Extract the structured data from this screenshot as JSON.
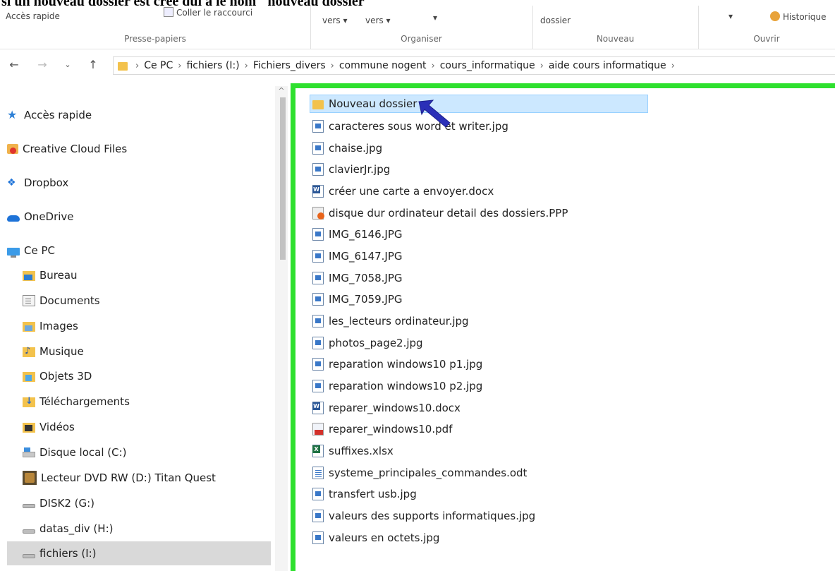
{
  "caption": "si un nouveau dossier est créé qui a le nom \"nouveau dossier\"",
  "ribbon": {
    "quick_access": "Accès rapide",
    "paste_shortcut": "Coller le raccourci",
    "move_to": "vers ▾",
    "copy_to": "vers ▾",
    "delete_arrow": "▾",
    "new_folder_label": "dossier",
    "properties_arrow": "▾",
    "history": "Historique",
    "groups": {
      "clipboard": "Presse-papiers",
      "organize": "Organiser",
      "new": "Nouveau",
      "open": "Ouvrir"
    }
  },
  "address": {
    "crumbs": [
      "Ce PC",
      "fichiers (I:)",
      "Fichiers_divers",
      "commune nogent",
      "cours_informatique",
      "aide cours informatique"
    ]
  },
  "sidebar": {
    "items": [
      {
        "label": "Accès rapide",
        "icon": "star-icon"
      },
      {
        "label": "Creative Cloud Files",
        "icon": "creative-cloud-icon"
      },
      {
        "label": "Dropbox",
        "icon": "dropbox-icon"
      },
      {
        "label": "OneDrive",
        "icon": "onedrive-icon"
      },
      {
        "label": "Ce PC",
        "icon": "computer-icon"
      },
      {
        "label": "Bureau",
        "icon": "desktop-folder-icon"
      },
      {
        "label": "Documents",
        "icon": "documents-icon"
      },
      {
        "label": "Images",
        "icon": "pictures-folder-icon"
      },
      {
        "label": "Musique",
        "icon": "music-folder-icon"
      },
      {
        "label": "Objets 3D",
        "icon": "3d-objects-icon"
      },
      {
        "label": "Téléchargements",
        "icon": "downloads-icon"
      },
      {
        "label": "Vidéos",
        "icon": "videos-folder-icon"
      },
      {
        "label": "Disque local (C:)",
        "icon": "local-disk-icon"
      },
      {
        "label": "Lecteur DVD RW (D:) Titan Quest",
        "icon": "dvd-drive-icon"
      },
      {
        "label": "DISK2 (G:)",
        "icon": "drive-icon"
      },
      {
        "label": "datas_div (H:)",
        "icon": "drive-icon"
      },
      {
        "label": "fichiers (I:)",
        "icon": "drive-icon"
      }
    ]
  },
  "files": [
    {
      "name": "Nouveau dossier",
      "type": "folder"
    },
    {
      "name": "caracteres sous word et writer.jpg",
      "type": "img"
    },
    {
      "name": "chaise.jpg",
      "type": "img"
    },
    {
      "name": "clavierJr.jpg",
      "type": "img"
    },
    {
      "name": "créer une carte a envoyer.docx",
      "type": "doc"
    },
    {
      "name": "disque dur ordinateur detail des dossiers.PPP",
      "type": "ppp"
    },
    {
      "name": "IMG_6146.JPG",
      "type": "img"
    },
    {
      "name": "IMG_6147.JPG",
      "type": "img"
    },
    {
      "name": "IMG_7058.JPG",
      "type": "img"
    },
    {
      "name": "IMG_7059.JPG",
      "type": "img"
    },
    {
      "name": "les_lecteurs ordinateur.jpg",
      "type": "img"
    },
    {
      "name": "photos_page2.jpg",
      "type": "img"
    },
    {
      "name": "reparation windows10 p1.jpg",
      "type": "img"
    },
    {
      "name": "reparation windows10 p2.jpg",
      "type": "img"
    },
    {
      "name": "reparer_windows10.docx",
      "type": "doc"
    },
    {
      "name": "reparer_windows10.pdf",
      "type": "pdf"
    },
    {
      "name": "suffixes.xlsx",
      "type": "xls"
    },
    {
      "name": "systeme_principales_commandes.odt",
      "type": "odt"
    },
    {
      "name": "transfert usb.jpg",
      "type": "img"
    },
    {
      "name": "valeurs des supports informatiques.jpg",
      "type": "img"
    },
    {
      "name": "valeurs en octets.jpg",
      "type": "img"
    }
  ],
  "colors": {
    "highlight_border": "#2ee02e",
    "selection": "#cce8ff",
    "arrow": "#2a2fb8"
  }
}
